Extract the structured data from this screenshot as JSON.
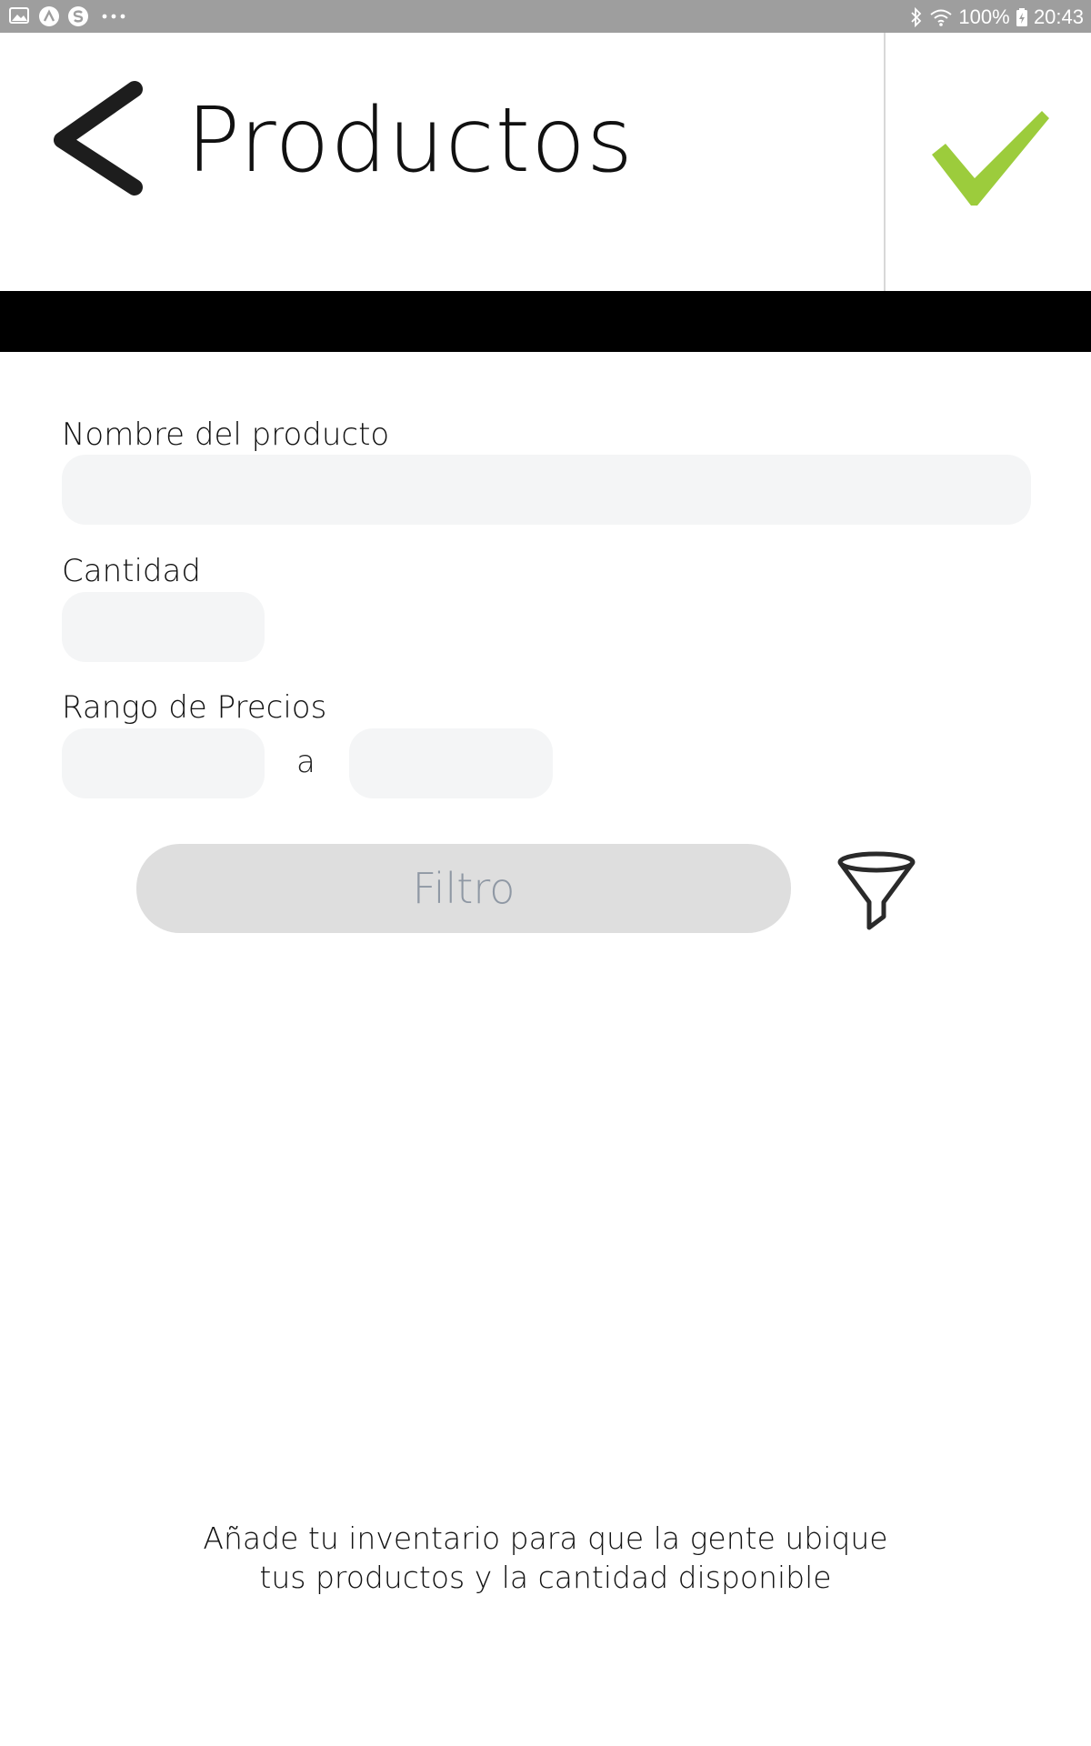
{
  "status_bar": {
    "left_icons": [
      "gallery-icon",
      "app-a-icon",
      "app-s-icon",
      "more-dots-icon"
    ],
    "right_icons": [
      "bluetooth-icon",
      "wifi-icon",
      "battery-charging-icon"
    ],
    "battery": "100%",
    "time": "20:43"
  },
  "header": {
    "title": "Productos",
    "back_icon": "chevron-left-icon",
    "confirm_icon": "checkmark-icon",
    "confirm_color": "#9ccc3c"
  },
  "form": {
    "name_label": "Nombre del producto",
    "name_value": "",
    "quantity_label": "Cantidad",
    "quantity_value": "",
    "price_range_label": "Rango de Precios",
    "price_min_value": "",
    "price_separator": "a",
    "price_max_value": "",
    "filter_button": "Filtro",
    "filter_icon": "funnel-icon"
  },
  "footer": {
    "line1": "Añade tu inventario para que la gente ubique",
    "line2": "tus productos y la cantidad disponible"
  },
  "colors": {
    "status_bar": "#9e9e9e",
    "header_bar": "#000000",
    "input_bg": "#f4f5f6",
    "button_bg": "#dedede",
    "button_text": "#8f98a4"
  }
}
